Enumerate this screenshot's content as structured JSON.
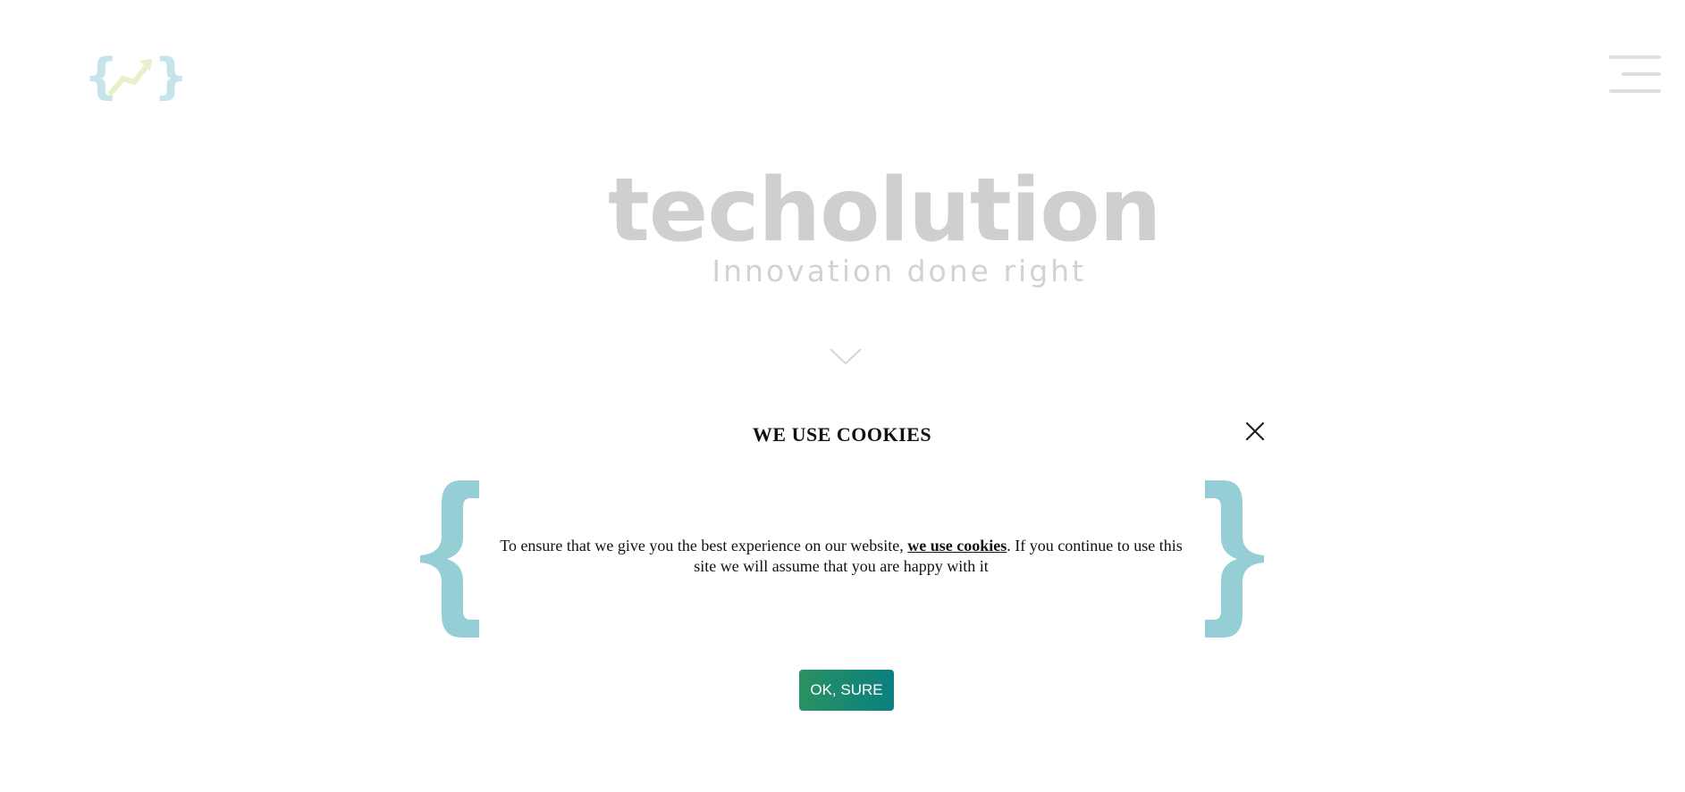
{
  "header": {
    "logo_icon": "curly-braces-arrow-logo",
    "menu_icon": "hamburger-menu-icon"
  },
  "hero": {
    "brand_name": "techolution",
    "tagline": "Innovation done right",
    "scroll_icon": "chevron-down-icon"
  },
  "cookie_modal": {
    "title": "WE USE COOKIES",
    "close_icon": "close-icon",
    "message_before": "To ensure that we give you the best experience on our website, ",
    "message_link": "we use cookies",
    "message_after": ". If you continue to use this site we will assume that you are happy with it",
    "accept_label": "OK, SURE",
    "brace_icon_left": "left-curly-brace-icon",
    "brace_icon_right": "right-curly-brace-icon"
  },
  "colors": {
    "brace": "#96ced6",
    "accept_gradient_start": "#2a9161",
    "accept_gradient_end": "#0a8080",
    "brand_text": "#cfcfcf",
    "logo_arrow": "#c8dc8c"
  }
}
